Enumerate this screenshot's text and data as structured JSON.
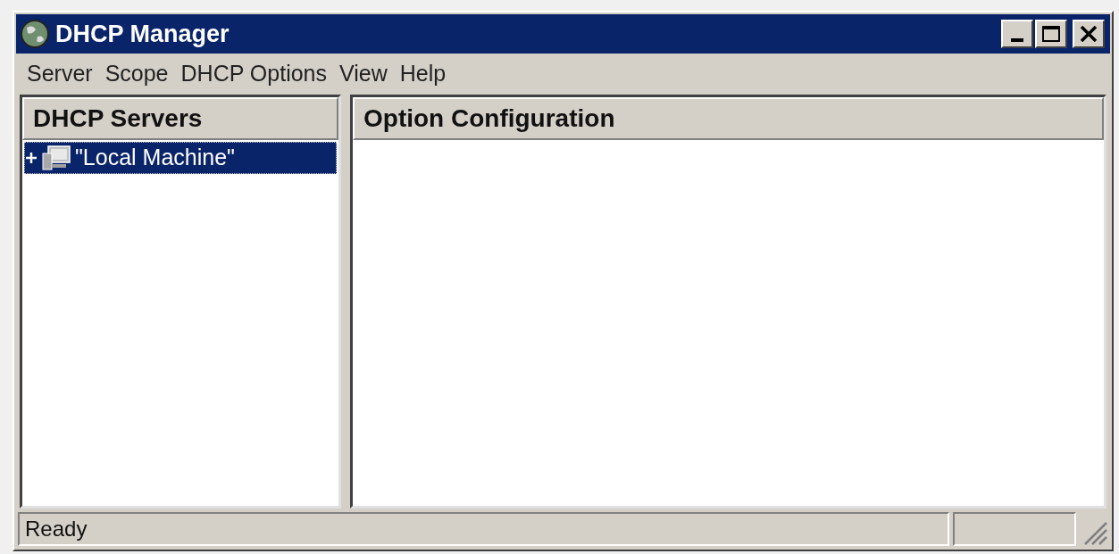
{
  "window": {
    "title": "DHCP Manager"
  },
  "menu": [
    "Server",
    "Scope",
    "DHCP Options",
    "View",
    "Help"
  ],
  "servers_pane": {
    "title": "DHCP Servers",
    "items": [
      {
        "label": "\"Local Machine\"",
        "selected": true,
        "expanded": false
      }
    ]
  },
  "options_pane": {
    "title": "Option Configuration"
  },
  "status_bar": {
    "text": "Ready"
  }
}
